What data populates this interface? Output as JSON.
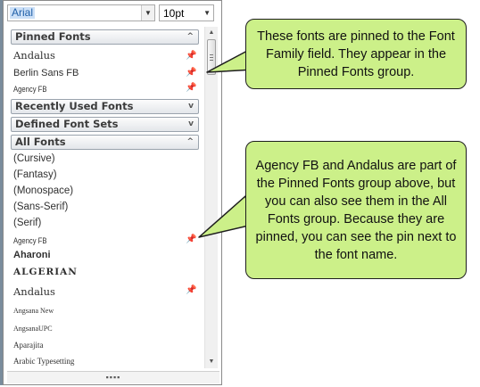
{
  "font_combo": {
    "value": "Arial"
  },
  "size_combo": {
    "value": "10pt"
  },
  "groups": {
    "pinned": {
      "label": "Pinned Fonts",
      "chevron": "^",
      "items": [
        "Andalus",
        "Berlin Sans FB",
        "Agency FB"
      ]
    },
    "recent": {
      "label": "Recently Used Fonts",
      "chevron": "v"
    },
    "defined": {
      "label": "Defined Font Sets",
      "chevron": "v"
    },
    "all": {
      "label": "All Fonts",
      "chevron": "^",
      "items": [
        "(Cursive)",
        "(Fantasy)",
        "(Monospace)",
        "(Sans-Serif)",
        "(Serif)",
        "Agency FB",
        "Aharoni",
        "ALGERIAN",
        "Andalus",
        "Angsana New",
        "AngsanaUPC",
        "Aparajita",
        "Arabic Typesetting"
      ]
    }
  },
  "pin_icon": "pin-icon",
  "grip_text": "▪▪▪▪",
  "callouts": {
    "pinned_note": "These fonts are pinned to the Font Family field. They appear in the Pinned Fonts group.",
    "all_fonts_note": "Agency FB and Andalus are part of the Pinned Fonts group above, but you can also see them in the All Fonts group. Because they are pinned, you can see the pin next to the font name."
  },
  "colors": {
    "callout_fill": "#ccf089",
    "selection": "#cce0f7"
  }
}
